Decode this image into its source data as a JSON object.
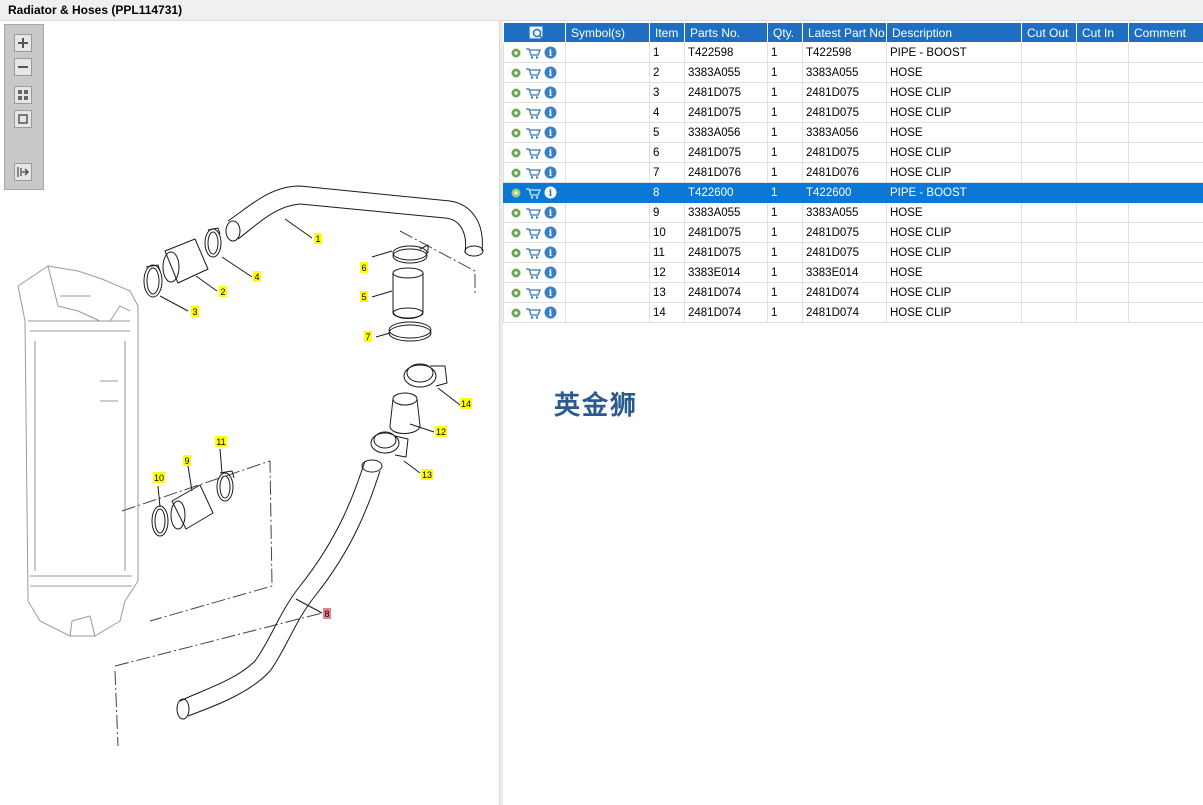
{
  "window": {
    "title": "Radiator & Hoses (PPL114731)"
  },
  "toolbar": {
    "buttons": [
      {
        "name": "zoom-in-button",
        "icon": "plus-icon"
      },
      {
        "name": "zoom-out-button",
        "icon": "minus-icon"
      },
      {
        "name": "fit-all-button",
        "icon": "grid-icon"
      },
      {
        "name": "fit-window-button",
        "icon": "square-icon"
      },
      {
        "name": "export-button",
        "icon": "list-arrow-icon"
      }
    ]
  },
  "diagram": {
    "callouts": [
      "1",
      "2",
      "3",
      "4",
      "5",
      "6",
      "7",
      "8",
      "9",
      "10",
      "11",
      "12",
      "13",
      "14"
    ]
  },
  "table": {
    "columns": [
      "",
      "Symbol(s)",
      "Item",
      "Parts No.",
      "Qty.",
      "Latest Part No.",
      "Description",
      "Cut Out",
      "Cut In",
      "Comment"
    ],
    "rows": [
      {
        "item": "1",
        "part": "T422598",
        "qty": "1",
        "latest": "T422598",
        "desc": "PIPE - BOOST"
      },
      {
        "item": "2",
        "part": "3383A055",
        "qty": "1",
        "latest": "3383A055",
        "desc": "HOSE"
      },
      {
        "item": "3",
        "part": "2481D075",
        "qty": "1",
        "latest": "2481D075",
        "desc": "HOSE CLIP"
      },
      {
        "item": "4",
        "part": "2481D075",
        "qty": "1",
        "latest": "2481D075",
        "desc": "HOSE CLIP"
      },
      {
        "item": "5",
        "part": "3383A056",
        "qty": "1",
        "latest": "3383A056",
        "desc": "HOSE"
      },
      {
        "item": "6",
        "part": "2481D075",
        "qty": "1",
        "latest": "2481D075",
        "desc": "HOSE CLIP"
      },
      {
        "item": "7",
        "part": "2481D076",
        "qty": "1",
        "latest": "2481D076",
        "desc": "HOSE CLIP"
      },
      {
        "item": "8",
        "part": "T422600",
        "qty": "1",
        "latest": "T422600",
        "desc": "PIPE - BOOST"
      },
      {
        "item": "9",
        "part": "3383A055",
        "qty": "1",
        "latest": "3383A055",
        "desc": "HOSE"
      },
      {
        "item": "10",
        "part": "2481D075",
        "qty": "1",
        "latest": "2481D075",
        "desc": "HOSE CLIP"
      },
      {
        "item": "11",
        "part": "2481D075",
        "qty": "1",
        "latest": "2481D075",
        "desc": "HOSE CLIP"
      },
      {
        "item": "12",
        "part": "3383E014",
        "qty": "1",
        "latest": "3383E014",
        "desc": "HOSE"
      },
      {
        "item": "13",
        "part": "2481D074",
        "qty": "1",
        "latest": "2481D074",
        "desc": "HOSE CLIP"
      },
      {
        "item": "14",
        "part": "2481D074",
        "qty": "1",
        "latest": "2481D074",
        "desc": "HOSE CLIP"
      }
    ],
    "selected_item": "8"
  },
  "watermark": "英金狮",
  "colors": {
    "header_blue": "#1e6fc2",
    "selected_row": "#0b78d6",
    "callout_yellow": "#ffff00",
    "callout_selected": "#e8808a"
  }
}
